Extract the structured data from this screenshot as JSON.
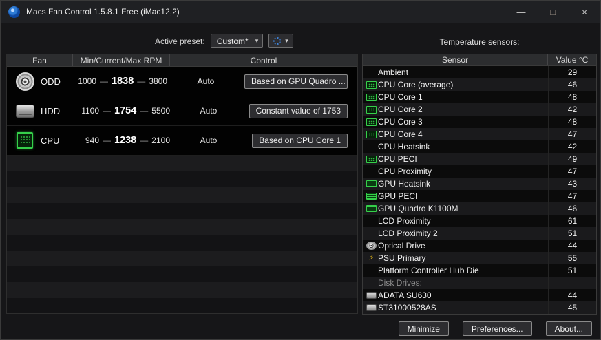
{
  "window": {
    "title": "Macs Fan Control 1.5.8.1 Free (iMac12,2)",
    "minimize_glyph": "—",
    "maximize_glyph": "□",
    "close_glyph": "×"
  },
  "icons": {
    "dropdown_glyph": "▾",
    "glyphs": {
      "psu-lightning": "⚡"
    }
  },
  "preset": {
    "label": "Active preset:",
    "value": "Custom*"
  },
  "fan_table": {
    "rpm_separator": "—",
    "headers": {
      "fan": "Fan",
      "rpm": "Min/Current/Max RPM",
      "control": "Control"
    },
    "rows": [
      {
        "name": "ODD",
        "icon": "optical-disc",
        "min": "1000",
        "current": "1838",
        "max": "3800",
        "mode": "Auto",
        "button": "Based on GPU Quadro ..."
      },
      {
        "name": "HDD",
        "icon": "hard-drive",
        "min": "1100",
        "current": "1754",
        "max": "5500",
        "mode": "Auto",
        "button": "Constant value of 1753"
      },
      {
        "name": "CPU",
        "icon": "cpu-chip",
        "min": "940",
        "current": "1238",
        "max": "2100",
        "mode": "Auto",
        "button": "Based on CPU Core 1"
      }
    ]
  },
  "sensors": {
    "title": "Temperature sensors:",
    "headers": {
      "sensor": "Sensor",
      "value": "Value °C"
    },
    "rows": [
      {
        "name": "Ambient",
        "value": "29",
        "icon": ""
      },
      {
        "name": "CPU Core (average)",
        "value": "46",
        "icon": "cpu-chip"
      },
      {
        "name": "CPU Core 1",
        "value": "48",
        "icon": "cpu-chip"
      },
      {
        "name": "CPU Core 2",
        "value": "42",
        "icon": "cpu-chip"
      },
      {
        "name": "CPU Core 3",
        "value": "48",
        "icon": "cpu-chip"
      },
      {
        "name": "CPU Core 4",
        "value": "47",
        "icon": "cpu-chip"
      },
      {
        "name": "CPU Heatsink",
        "value": "42",
        "icon": ""
      },
      {
        "name": "CPU PECI",
        "value": "49",
        "icon": "cpu-chip"
      },
      {
        "name": "CPU Proximity",
        "value": "47",
        "icon": ""
      },
      {
        "name": "GPU Heatsink",
        "value": "43",
        "icon": "gpu-chip"
      },
      {
        "name": "GPU PECI",
        "value": "47",
        "icon": "gpu-chip"
      },
      {
        "name": "GPU Quadro K1100M",
        "value": "46",
        "icon": "gpu-chip"
      },
      {
        "name": "LCD Proximity",
        "value": "61",
        "icon": ""
      },
      {
        "name": "LCD Proximity 2",
        "value": "51",
        "icon": ""
      },
      {
        "name": "Optical Drive",
        "value": "44",
        "icon": "optical-disc"
      },
      {
        "name": "PSU Primary",
        "value": "55",
        "icon": "psu-lightning"
      },
      {
        "name": "Platform Controller Hub Die",
        "value": "51",
        "icon": ""
      },
      {
        "name": "Disk Drives:",
        "value": "",
        "icon": "",
        "section": true
      },
      {
        "name": "ADATA SU630",
        "value": "44",
        "icon": "disk-drive"
      },
      {
        "name": "ST31000528AS",
        "value": "45",
        "icon": "disk-drive"
      }
    ]
  },
  "footer": {
    "minimize": "Minimize",
    "preferences": "Preferences...",
    "about": "About..."
  }
}
